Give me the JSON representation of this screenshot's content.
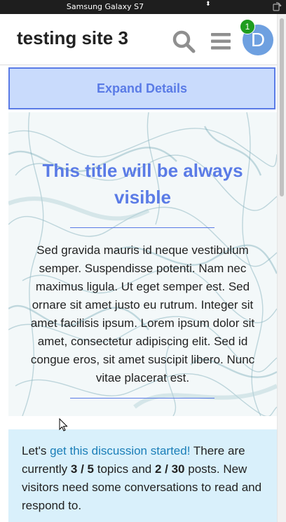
{
  "devtools": {
    "device_name": "Samsung Galaxy S7",
    "device_selector_arrows": "⬍"
  },
  "header": {
    "site_title": "testing site 3",
    "notification_count": "1",
    "avatar_letter": "D"
  },
  "expand_button": {
    "label": "Expand Details"
  },
  "hero": {
    "title": "This title will be always visible",
    "body": "Sed gravida mauris id neque vestibulum semper. Suspendisse potenti. Nam nec maximus ligula. Ut eget semper est. Sed ornare sit amet justo eu rutrum. Integer sit amet facilisis ipsum. Lorem ipsum dolor sit amet, consectetur adipiscing elit. Sed id congue eros, sit amet suscipit libero. Nunc vitae placerat est."
  },
  "discussion": {
    "prefix": "Let's ",
    "link_text": "get this discussion started!",
    "part1": " There are currently ",
    "topics": "3 / 5",
    "part2": " topics and ",
    "posts": "2 / 30",
    "part3": " posts. New visitors need some conversations to read and respond to."
  },
  "colors": {
    "accent": "#5a7be6",
    "expand_bg": "#c9dbfc",
    "discussion_bg": "#d9f0fb",
    "link": "#1a7eb8",
    "notification": "#1f9d1f",
    "avatar": "#6ea0e0"
  }
}
